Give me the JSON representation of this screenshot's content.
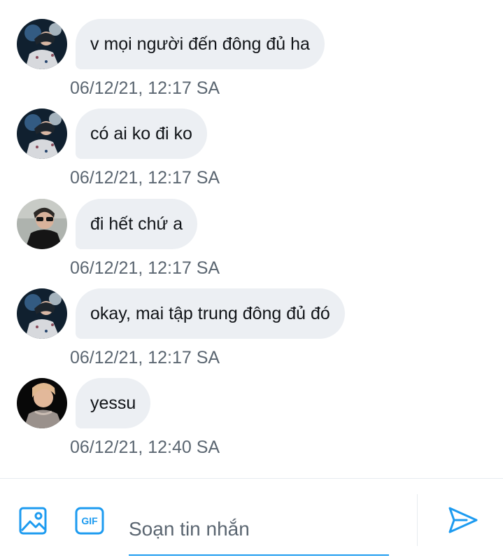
{
  "messages": [
    {
      "text": "v mọi người đến đông đủ ha",
      "time": "06/12/21, 12:17 SA",
      "avatar": "user-avatar-a"
    },
    {
      "text": "có ai ko đi ko",
      "time": "06/12/21, 12:17 SA",
      "avatar": "user-avatar-a"
    },
    {
      "text": "đi hết chứ a",
      "time": "06/12/21, 12:17 SA",
      "avatar": "user-avatar-b"
    },
    {
      "text": "okay, mai tập trung đông đủ đó",
      "time": "06/12/21, 12:17 SA",
      "avatar": "user-avatar-a"
    },
    {
      "text": "yessu",
      "time": "06/12/21, 12:40 SA",
      "avatar": "user-avatar-c"
    }
  ],
  "composer": {
    "placeholder": "Soạn tin nhắn",
    "value": "",
    "gif_label": "GIF",
    "icons": [
      "image-icon",
      "gif-icon",
      "send-icon"
    ]
  },
  "colors": {
    "bubble": "#eceff3",
    "accent": "#1d9bf0",
    "timestamp": "#5b6671"
  }
}
